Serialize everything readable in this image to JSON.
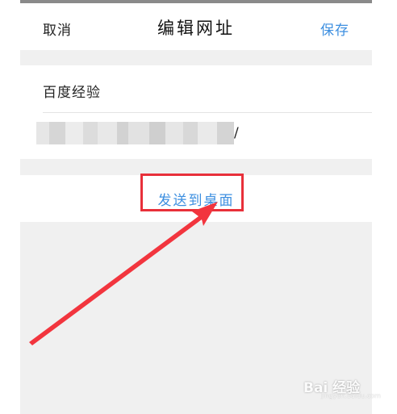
{
  "nav": {
    "cancel_label": "取消",
    "title": "编辑网址",
    "save_label": "保存"
  },
  "bookmark": {
    "title_value": "百度经验",
    "url_visible_tail": "/"
  },
  "actions": {
    "send_to_desktop_label": "发送到桌面"
  },
  "watermark": {
    "logo_text": "Bai 经验",
    "sub_text": "jingyan.baidu.com"
  },
  "colors": {
    "accent": "#3d8fe0",
    "highlight": "#e8303a",
    "background": "#f0f0f0"
  },
  "icons": {
    "annotation_arrow": "red-arrow-icon",
    "watermark_paw": "baidu-paw-icon"
  }
}
